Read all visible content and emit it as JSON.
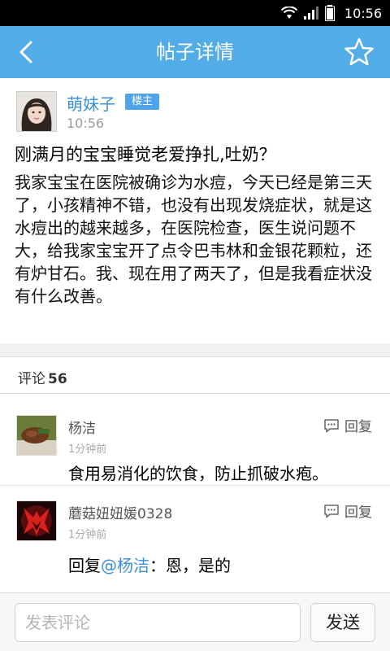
{
  "status_bar": {
    "time": "10:56"
  },
  "header": {
    "title": "帖子详情",
    "back_icon": "back-arrow-icon",
    "favorite_icon": "star-icon"
  },
  "post": {
    "author": "萌妹子",
    "badge": "楼主",
    "time": "10:56",
    "title": "刚满月的宝宝睡觉老爱挣扎,吐奶？",
    "body": "我家宝宝在医院被确诊为水痘，今天已经是第三天了，小孩精神不错，也没有出现发烧症状，就是这水痘出的越来越多，在医院检查，医生说问题不大，给我家宝宝开了点令巴韦林和金银花颗粒，还有炉甘石。我、现在用了两天了，但是我看症状没有什么改善。"
  },
  "comments_section": {
    "label": "评论",
    "count": "56"
  },
  "comments": [
    {
      "author": "杨洁",
      "time": "1分钟前",
      "text": "食用易消化的饮食，防止抓破水疱。",
      "reply_label": "回复"
    },
    {
      "author": "蘑菇妞妞媛0328",
      "time": "1分钟前",
      "text_prefix": "回复",
      "mention": "@杨洁",
      "text_suffix": "：恩，是的",
      "reply_label": "回复"
    }
  ],
  "input_bar": {
    "placeholder": "发表评论",
    "send_label": "发送"
  },
  "colors": {
    "header_bg": "#51ace7",
    "link_blue": "#3a8fd6",
    "badge_bg": "#4fa3e8"
  }
}
